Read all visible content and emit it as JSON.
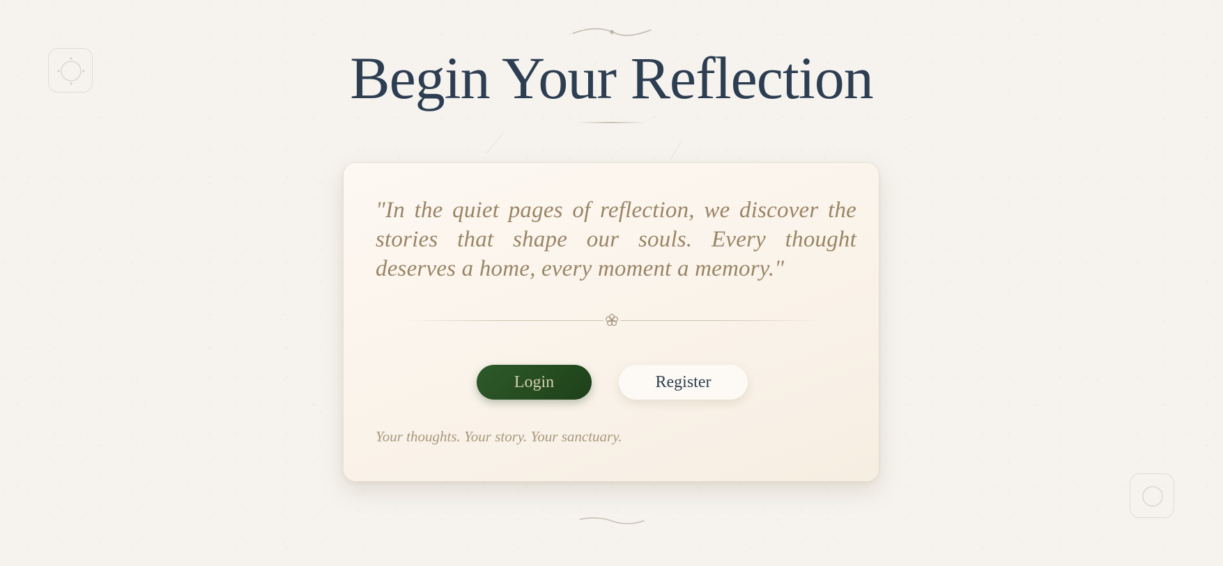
{
  "header": {
    "title": "Begin Your Reflection"
  },
  "card": {
    "quote": "\"In the quiet pages of reflection, we discover the stories that shape our souls. Every thought deserves a home, every moment a memory.\"",
    "divider_icon": "flower-icon",
    "login_label": "Login",
    "register_label": "Register",
    "tagline": "Your thoughts. Your story. Your sanctuary."
  },
  "decorations": {
    "top_flourish": "flourish-icon",
    "bottom_flourish": "flourish-icon",
    "corner_top_left": "sun-ornament-icon",
    "corner_bottom_right": "circle-ornament-icon"
  },
  "colors": {
    "background": "#f6f3ee",
    "title": "#2d3e52",
    "quote": "#9a8565",
    "login_button": "#2e5a2a",
    "login_text": "#d5cfae",
    "register_button": "#fdf9f4",
    "card_background": "#fdf8f2"
  }
}
